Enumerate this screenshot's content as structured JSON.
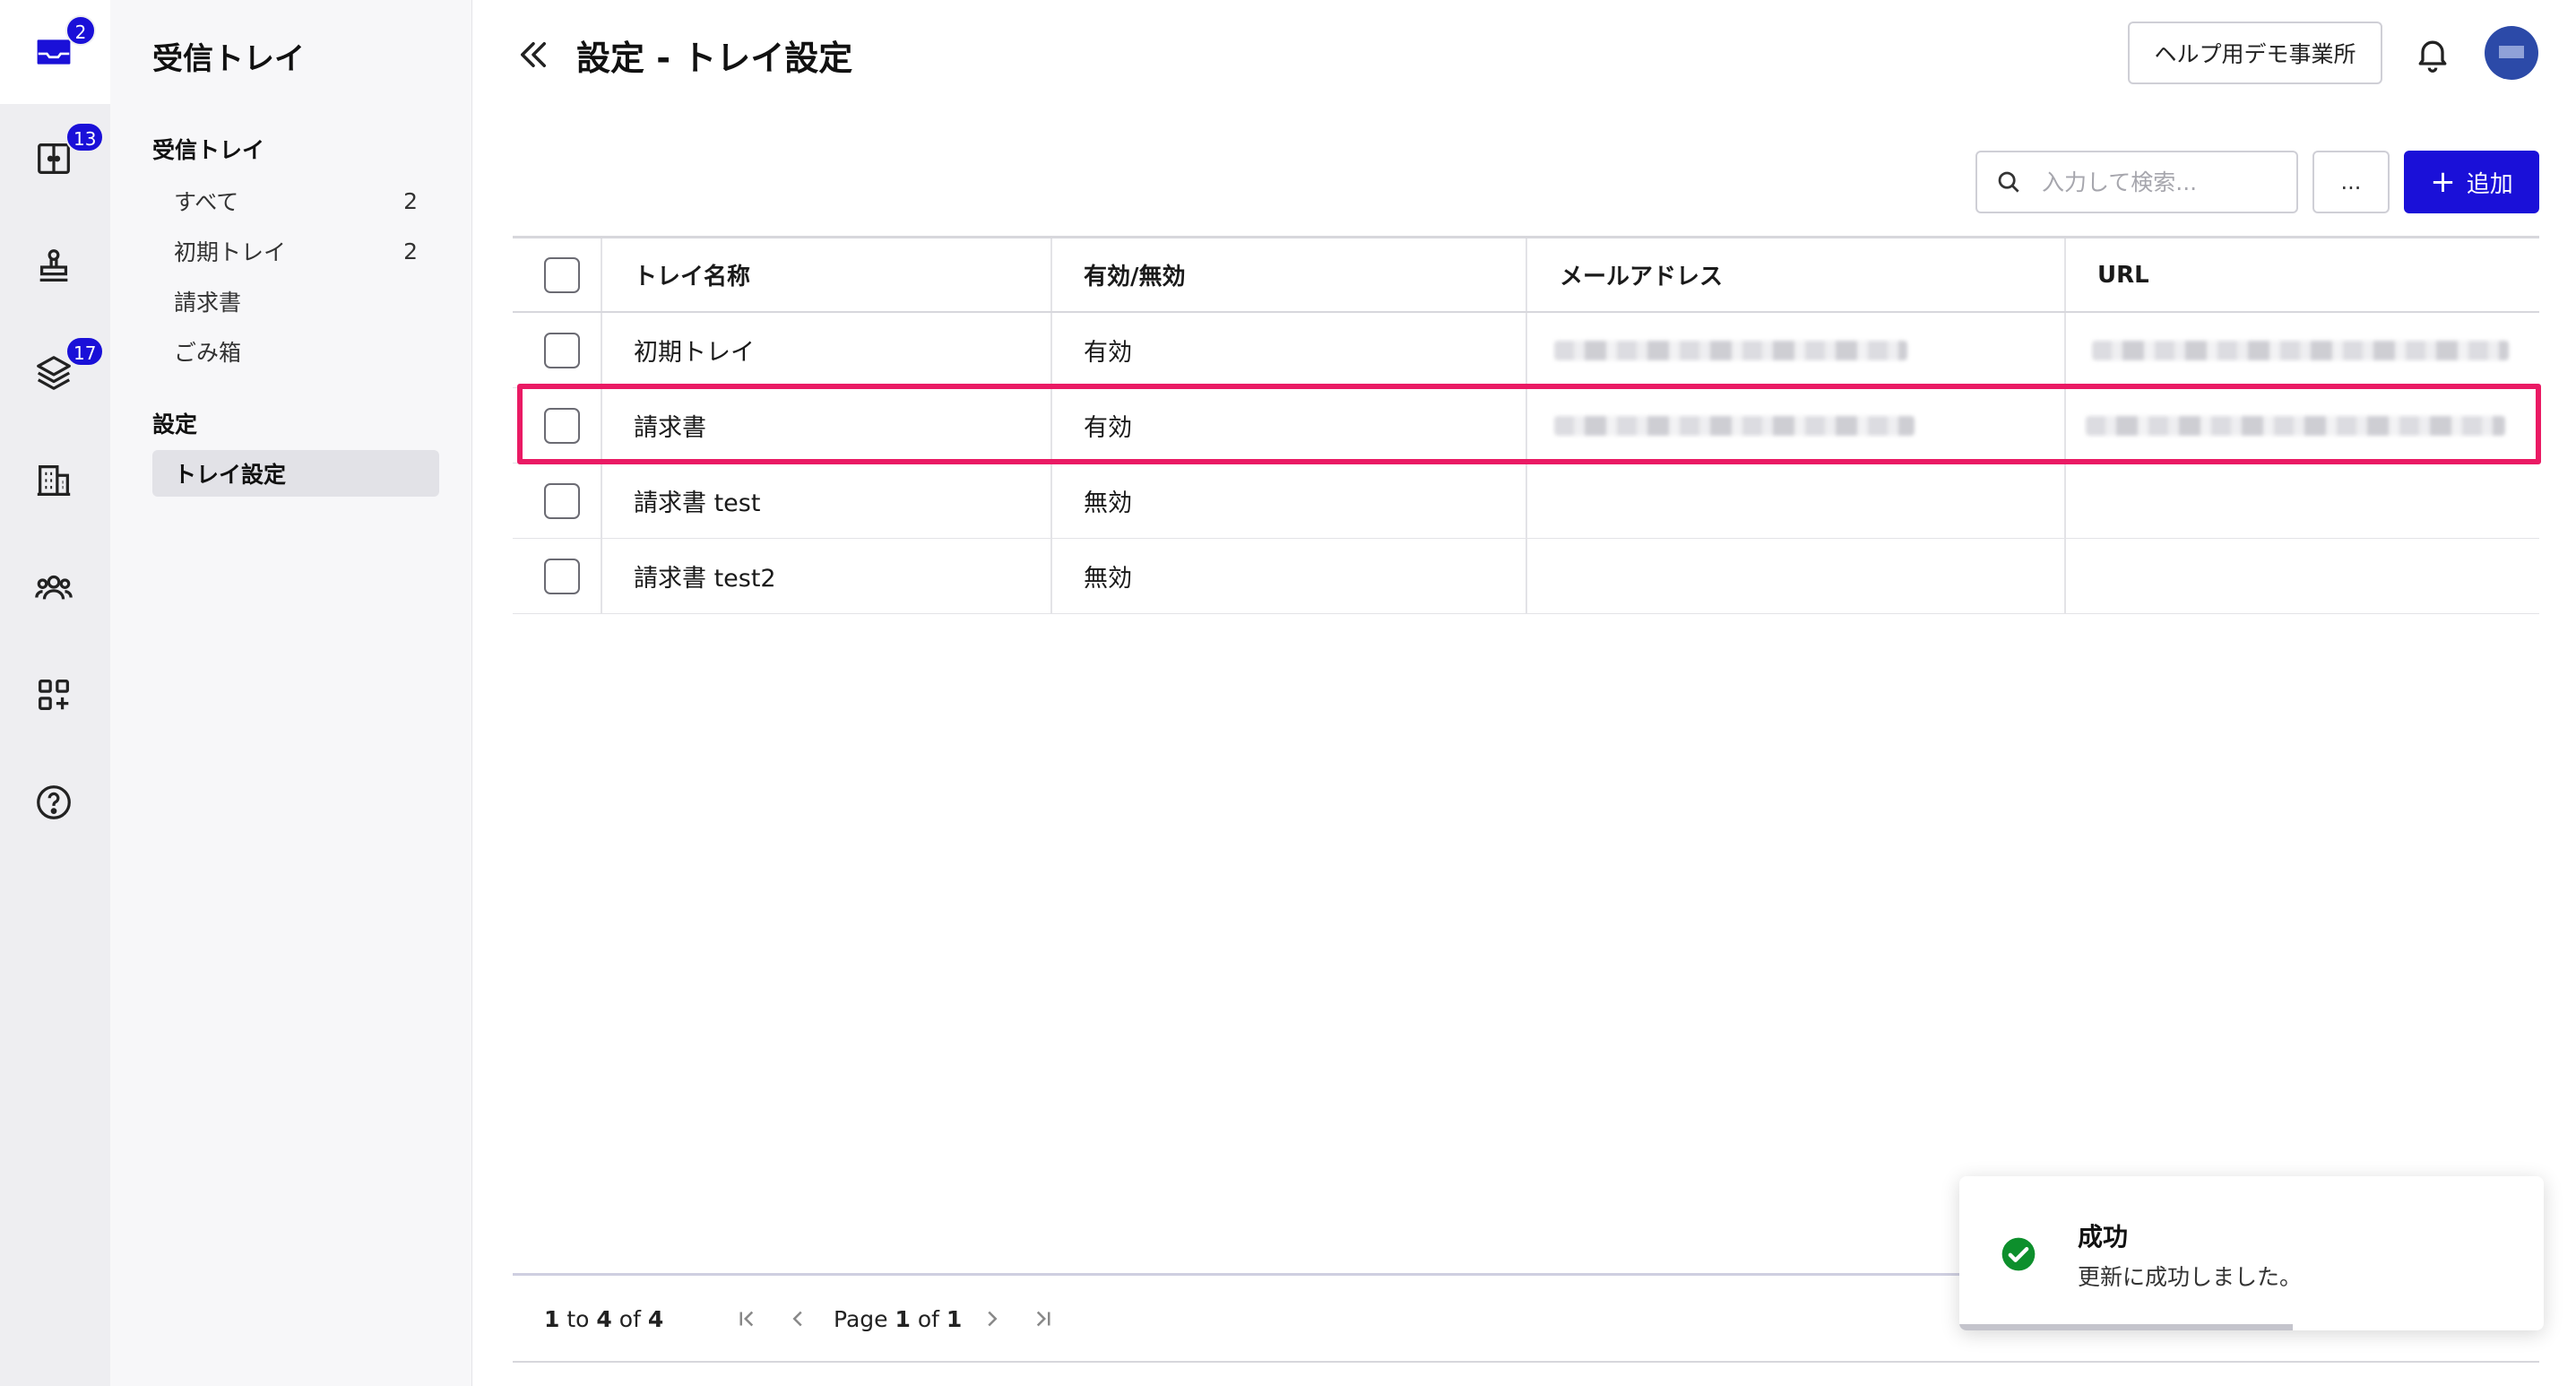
{
  "rail": {
    "inbox_badge": "2",
    "tray_badge": "13",
    "layers_badge": "17"
  },
  "sidebar": {
    "title": "受信トレイ",
    "inbox_section": "受信トレイ",
    "items": [
      {
        "label": "すべて",
        "count": "2"
      },
      {
        "label": "初期トレイ",
        "count": "2"
      },
      {
        "label": "請求書",
        "count": ""
      },
      {
        "label": "ごみ箱",
        "count": ""
      }
    ],
    "settings_section": "設定",
    "settings_items": [
      {
        "label": "トレイ設定",
        "active": true
      }
    ]
  },
  "header": {
    "title": "設定 - トレイ設定",
    "office_button": "ヘルプ用デモ事業所"
  },
  "toolbar": {
    "search_placeholder": "入力して検索...",
    "more_label": "...",
    "add_label": "追加"
  },
  "table": {
    "columns": [
      "トレイ名称",
      "有効/無効",
      "メールアドレス",
      "URL"
    ],
    "rows": [
      {
        "name": "初期トレイ",
        "status": "有効",
        "email_redacted": true,
        "url_redacted": true
      },
      {
        "name": "請求書",
        "status": "有効",
        "email_redacted": true,
        "url_redacted": true,
        "highlighted": true
      },
      {
        "name": "請求書 test",
        "status": "無効",
        "email_redacted": false,
        "url_redacted": false
      },
      {
        "name": "請求書 test2",
        "status": "無効",
        "email_redacted": false,
        "url_redacted": false
      }
    ]
  },
  "pagination": {
    "from": "1",
    "to_label": "to",
    "to": "4",
    "of_label": "of",
    "total": "4",
    "page_label": "Page",
    "page": "1",
    "page_of_label": "of",
    "page_total": "1"
  },
  "toast": {
    "title": "成功",
    "message": "更新に成功しました。",
    "progress": 0.57
  },
  "colors": {
    "accent": "#1a10d8",
    "highlight": "#ea1a64",
    "success": "#0d8f2c"
  }
}
